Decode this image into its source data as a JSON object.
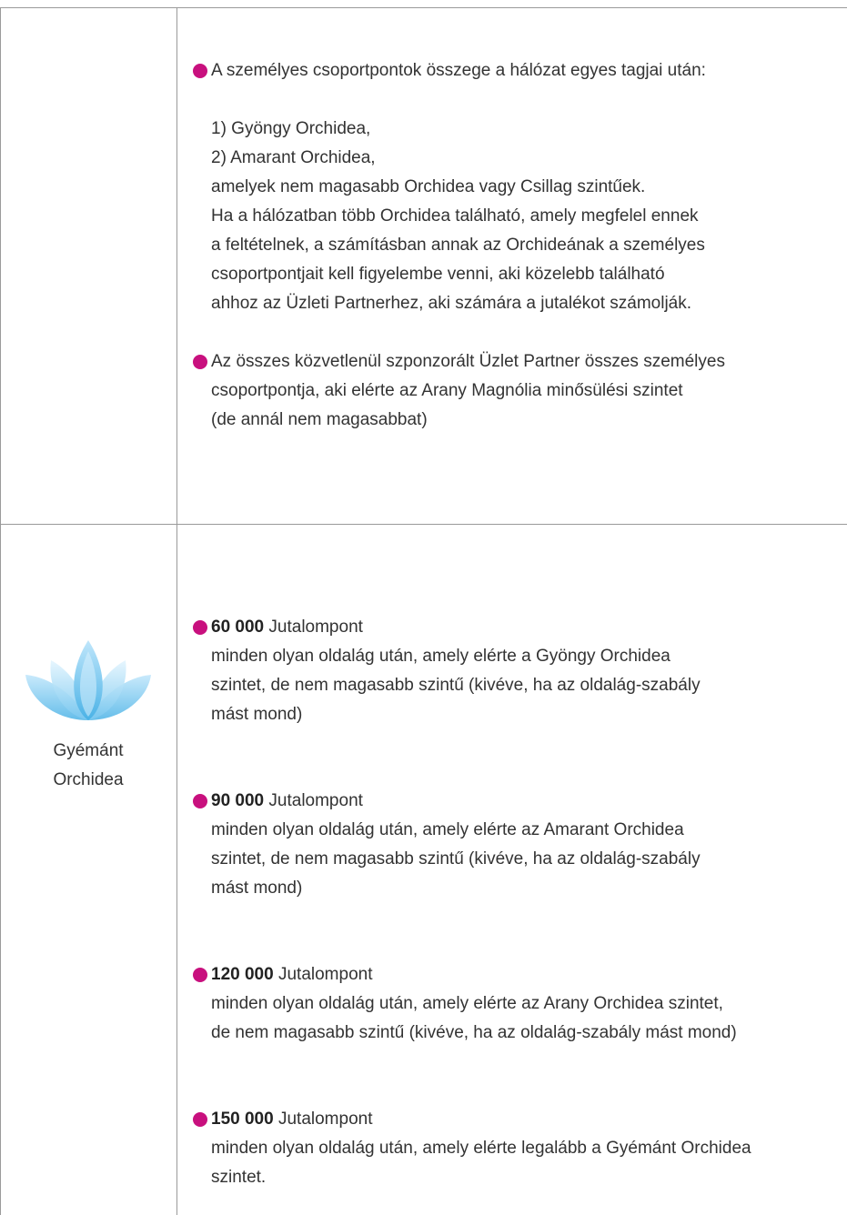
{
  "colors": {
    "bullet": "#c8107e",
    "border": "#9a9a9a",
    "lotus": "#7fc8ee"
  },
  "row1": {
    "bullet1": "A személyes csoportpontok összege a hálózat egyes tagjai után:",
    "list": [
      "1) Gyöngy Orchidea,",
      "2) Amarant Orchidea,"
    ],
    "lines": [
      "amelyek nem magasabb Orchidea vagy Csillag szintűek.",
      "Ha a hálózatban több Orchidea található, amely megfelel ennek",
      "a feltételnek, a számításban annak az Orchideának a személyes",
      "csoportpontjait kell figyelembe venni, aki közelebb található",
      "ahhoz az Üzleti Partnerhez, aki számára a jutalékot számolják."
    ],
    "bullet2": [
      "Az összes közvetlenül szponzorált Üzlet Partner összes személyes",
      "csoportpontja, aki elérte az Arany Magnólia minősülési szintet",
      "(de annál nem magasabbat)"
    ]
  },
  "row2": {
    "level_icon": "lotus-icon",
    "level_name": [
      "Gyémánt",
      "Orchidea"
    ],
    "rewards": [
      {
        "amount": "60 000",
        "unit": "Jutalompont",
        "lines": [
          "minden olyan oldalág után, amely elérte a Gyöngy Orchidea",
          "szintet, de nem magasabb szintű (kivéve, ha az oldalág-szabály",
          "mást mond)"
        ]
      },
      {
        "amount": "90 000",
        "unit": "Jutalompont",
        "lines": [
          "minden olyan oldalág után, amely elérte az Amarant Orchidea",
          "szintet, de nem magasabb szintű (kivéve, ha az oldalág-szabály",
          "mást mond)"
        ]
      },
      {
        "amount": "120 000",
        "unit": "Jutalompont",
        "lines": [
          "minden olyan oldalág után, amely elérte az Arany Orchidea szintet,",
          "de nem magasabb szintű (kivéve, ha az oldalág-szabály mást mond)"
        ]
      },
      {
        "amount": "150 000",
        "unit": "Jutalompont",
        "lines": [
          "minden olyan oldalág után, amely elérte legalább a Gyémánt Orchidea",
          "szintet."
        ]
      }
    ]
  }
}
